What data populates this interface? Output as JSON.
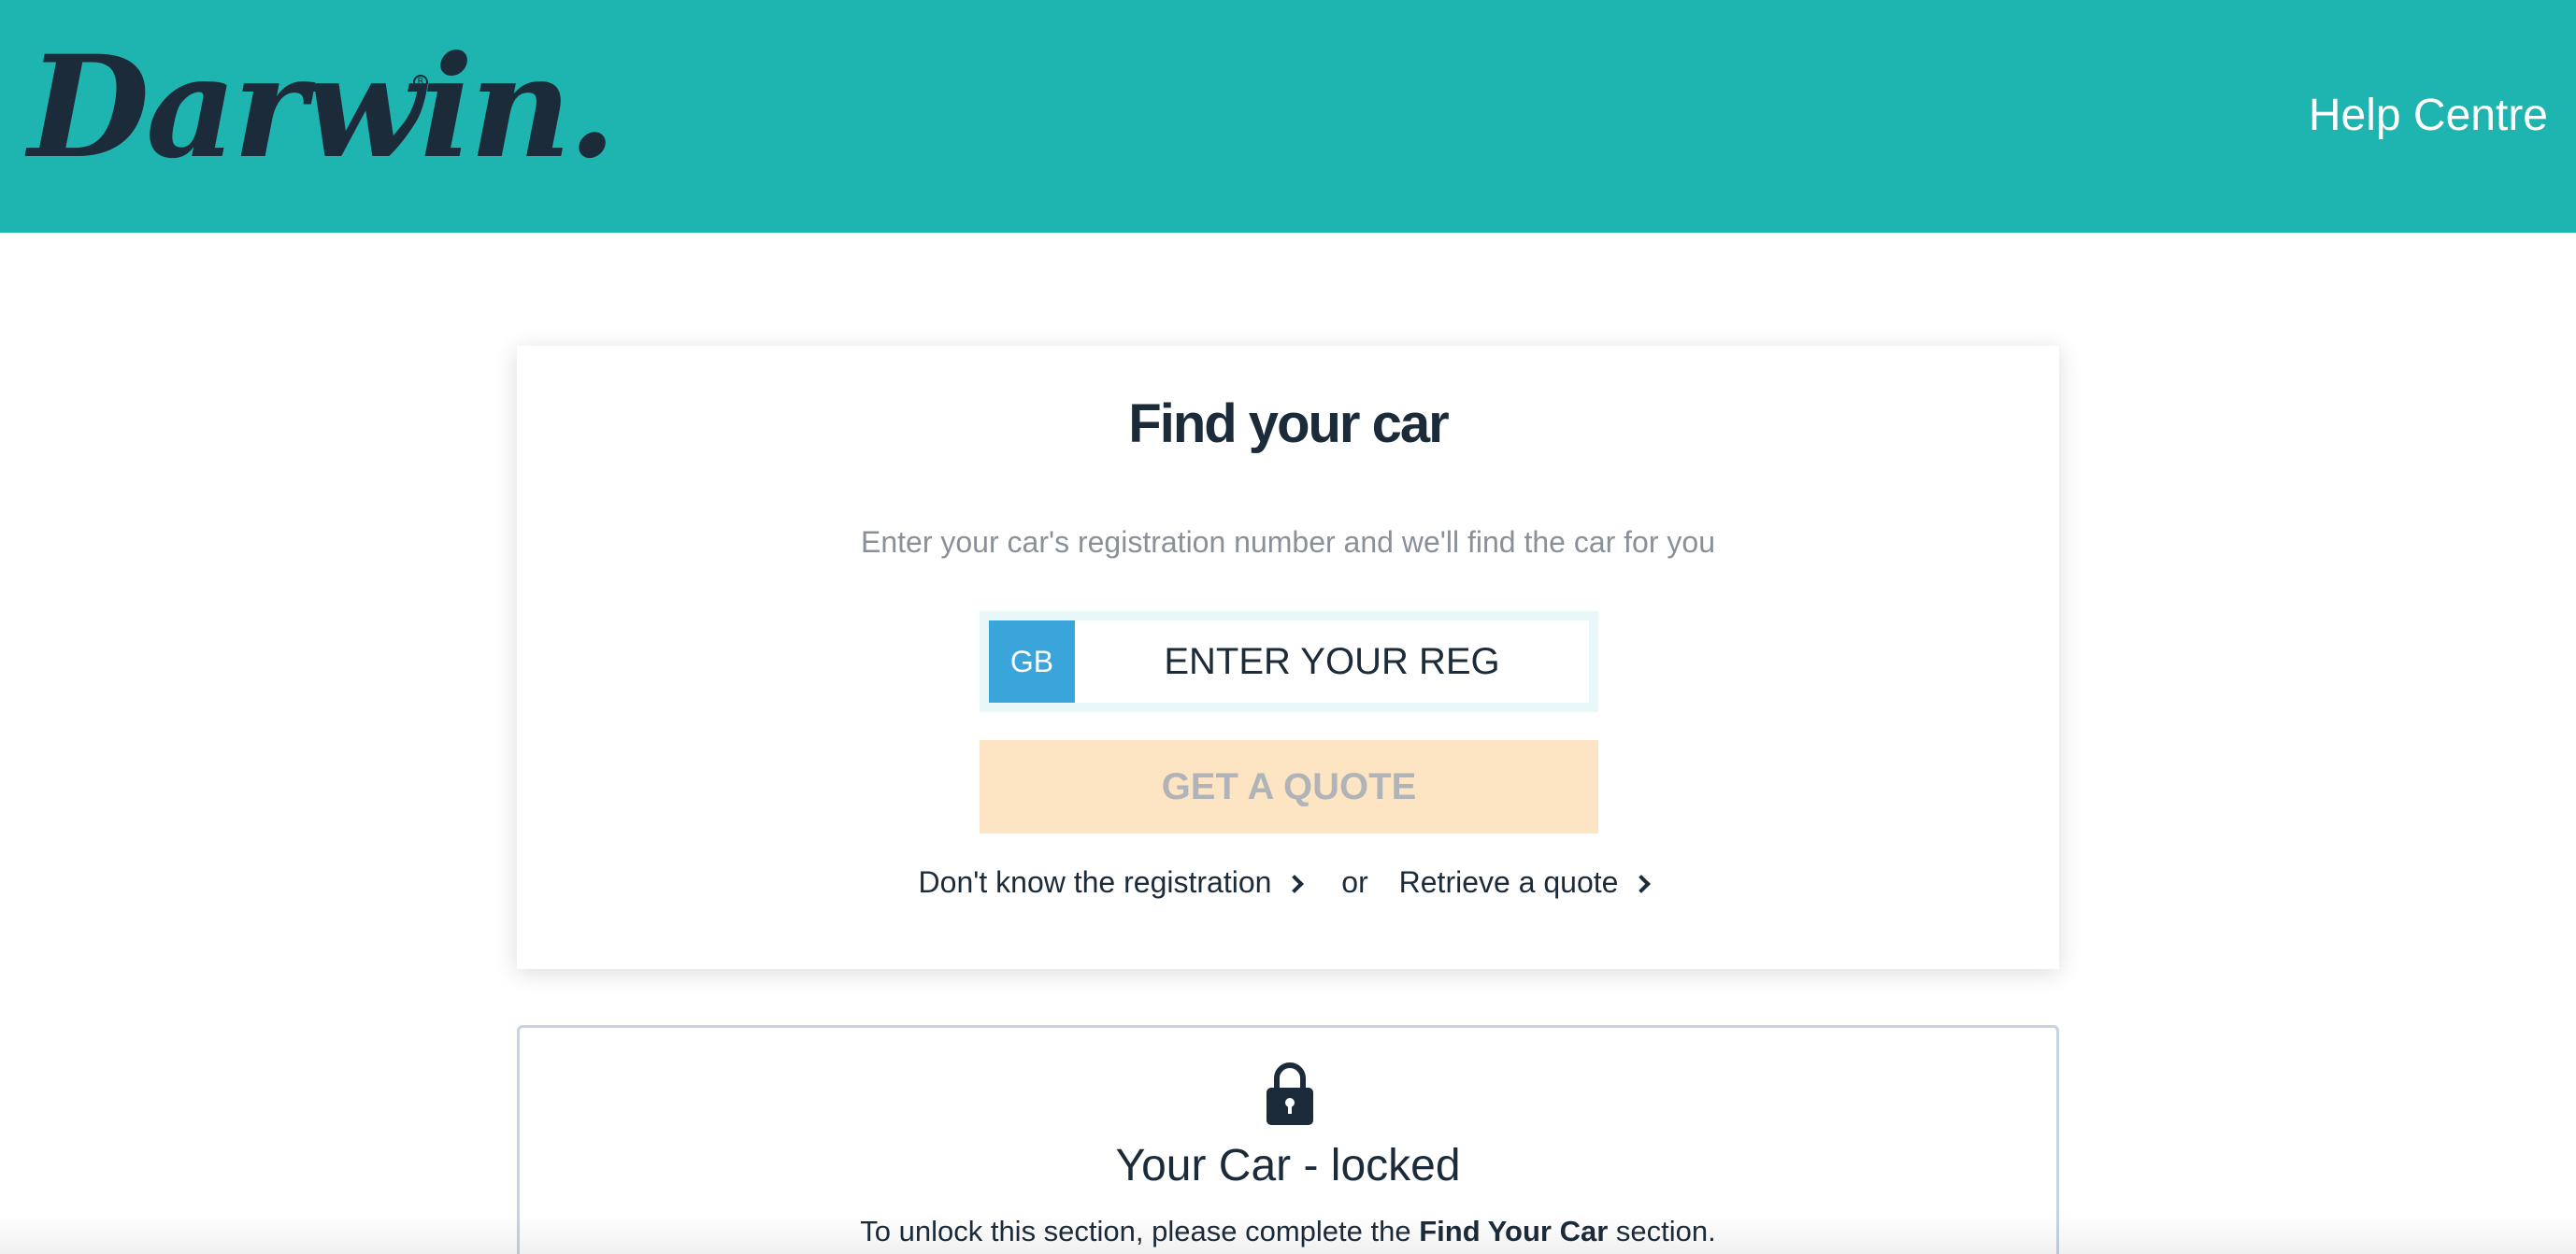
{
  "header": {
    "logo_text": "Darwin.",
    "help_link": "Help Centre",
    "background_color": "#1eb4b0"
  },
  "find_car": {
    "title": "Find your car",
    "subtitle": "Enter your car's registration number and we'll find the car for you",
    "reg_country": "GB",
    "reg_placeholder": "ENTER YOUR REG",
    "quote_button": "GET A QUOTE",
    "dont_know_link": "Don't know the registration",
    "or_text": "or",
    "retrieve_link": "Retrieve a quote"
  },
  "locked_section": {
    "icon": "lock-icon",
    "title": "Your Car - locked",
    "text_before": "To unlock this section, please complete the ",
    "text_bold": "Find Your Car",
    "text_after": " section."
  },
  "colors": {
    "brand_teal": "#1eb4b0",
    "navy": "#1c2b3a",
    "reg_blue": "#3aa5db",
    "quote_disabled_bg": "#fde5c3"
  }
}
